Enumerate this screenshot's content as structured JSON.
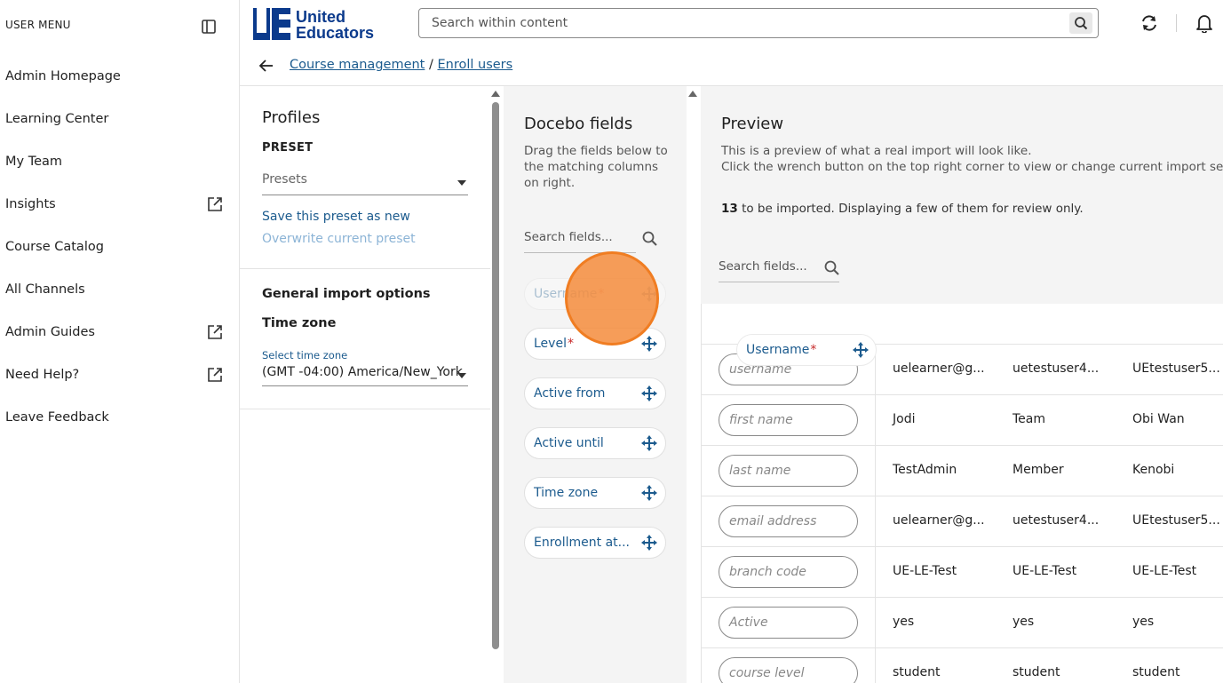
{
  "sidebar": {
    "title": "USER MENU",
    "items": [
      {
        "label": "Admin Homepage",
        "external": false
      },
      {
        "label": "Learning Center",
        "external": false
      },
      {
        "label": "My Team",
        "external": false
      },
      {
        "label": "Insights",
        "external": true
      },
      {
        "label": "Course Catalog",
        "external": false
      },
      {
        "label": "All Channels",
        "external": false
      },
      {
        "label": "Admin Guides",
        "external": true
      },
      {
        "label": "Need Help?",
        "external": true
      },
      {
        "label": "Leave Feedback",
        "external": false
      }
    ]
  },
  "header": {
    "logo_line1": "United",
    "logo_line2": "Educators",
    "search_placeholder": "Search within content"
  },
  "breadcrumb": {
    "link1": "Course management",
    "separator": " / ",
    "link2": "Enroll users"
  },
  "profiles": {
    "title": "Profiles",
    "preset_label": "PRESET",
    "presets_placeholder": "Presets",
    "save_link": "Save this preset as new",
    "overwrite_link": "Overwrite current preset",
    "general_heading": "General import options",
    "timezone_heading": "Time zone",
    "timezone_label": "Select time zone",
    "timezone_value": "(GMT -04:00) America/New_York"
  },
  "docebo": {
    "title": "Docebo fields",
    "description": "Drag the fields below to the matching columns on right.",
    "search_placeholder": "Search fields...",
    "fields": [
      {
        "label": "Username",
        "required": true,
        "ghost": true
      },
      {
        "label": "Level",
        "required": true,
        "ghost": false
      },
      {
        "label": "Active from",
        "required": false,
        "ghost": false
      },
      {
        "label": "Active until",
        "required": false,
        "ghost": false
      },
      {
        "label": "Time zone",
        "required": false,
        "ghost": false
      },
      {
        "label": "Enrollment at...",
        "required": false,
        "ghost": false
      }
    ]
  },
  "preview": {
    "title": "Preview",
    "desc_line1": "This is a preview of what a real import will look like.",
    "desc_line2": "Click the wrench button on the top right corner to view or change current import settin",
    "count": "13",
    "count_text": " to be imported. Displaying a few of them for review only.",
    "search_placeholder": "Search fields...",
    "rows": [
      {
        "slot": "username",
        "cells": [
          "uelearner@g...",
          "uetestuser4...",
          "UEtestuser5..."
        ]
      },
      {
        "slot": "first name",
        "cells": [
          "Jodi",
          "Team",
          "Obi Wan"
        ]
      },
      {
        "slot": "last name",
        "cells": [
          "TestAdmin",
          "Member",
          "Kenobi"
        ]
      },
      {
        "slot": "email address",
        "cells": [
          "uelearner@g...",
          "uetestuser4...",
          "UEtestuser5..."
        ]
      },
      {
        "slot": "branch code",
        "cells": [
          "UE-LE-Test",
          "UE-LE-Test",
          "UE-LE-Test"
        ]
      },
      {
        "slot": "Active",
        "cells": [
          "yes",
          "yes",
          "yes"
        ]
      },
      {
        "slot": "course level",
        "cells": [
          "student",
          "student",
          "student"
        ]
      }
    ]
  },
  "drag_pill": {
    "label": "Username",
    "required_mark": "*"
  },
  "colors": {
    "link": "#1c5b8e",
    "accent_orange": "#f07d22",
    "logo_blue": "#0b3a8c",
    "panel_bg": "#f4f4f4"
  }
}
